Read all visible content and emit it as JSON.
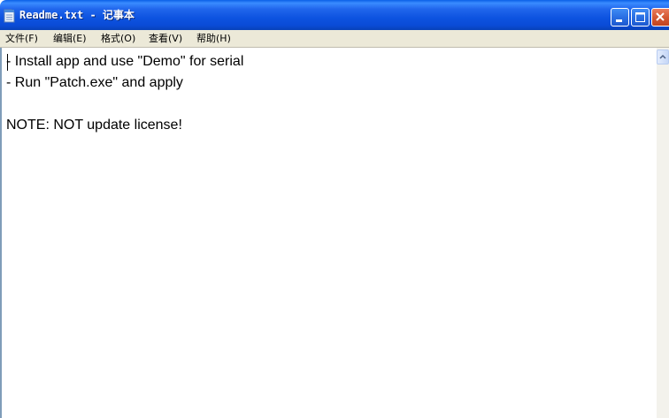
{
  "window": {
    "title": "Readme.txt - 记事本"
  },
  "menubar": {
    "items": [
      {
        "label": "文件(F)"
      },
      {
        "label": "编辑(E)"
      },
      {
        "label": "格式(O)"
      },
      {
        "label": "查看(V)"
      },
      {
        "label": "帮助(H)"
      }
    ]
  },
  "editor": {
    "content": "- Install app and use \"Demo\" for serial\n- Run \"Patch.exe\" and apply\n\nNOTE: NOT update license!"
  },
  "icons": {
    "app": "notepad-icon",
    "minimize": "minimize-icon",
    "maximize": "maximize-icon",
    "close": "close-icon",
    "scroll_up": "arrow-up-icon"
  },
  "colors": {
    "titlebar": "#0a53e0",
    "close_button": "#d55a35",
    "menubar": "#ece9d8"
  }
}
